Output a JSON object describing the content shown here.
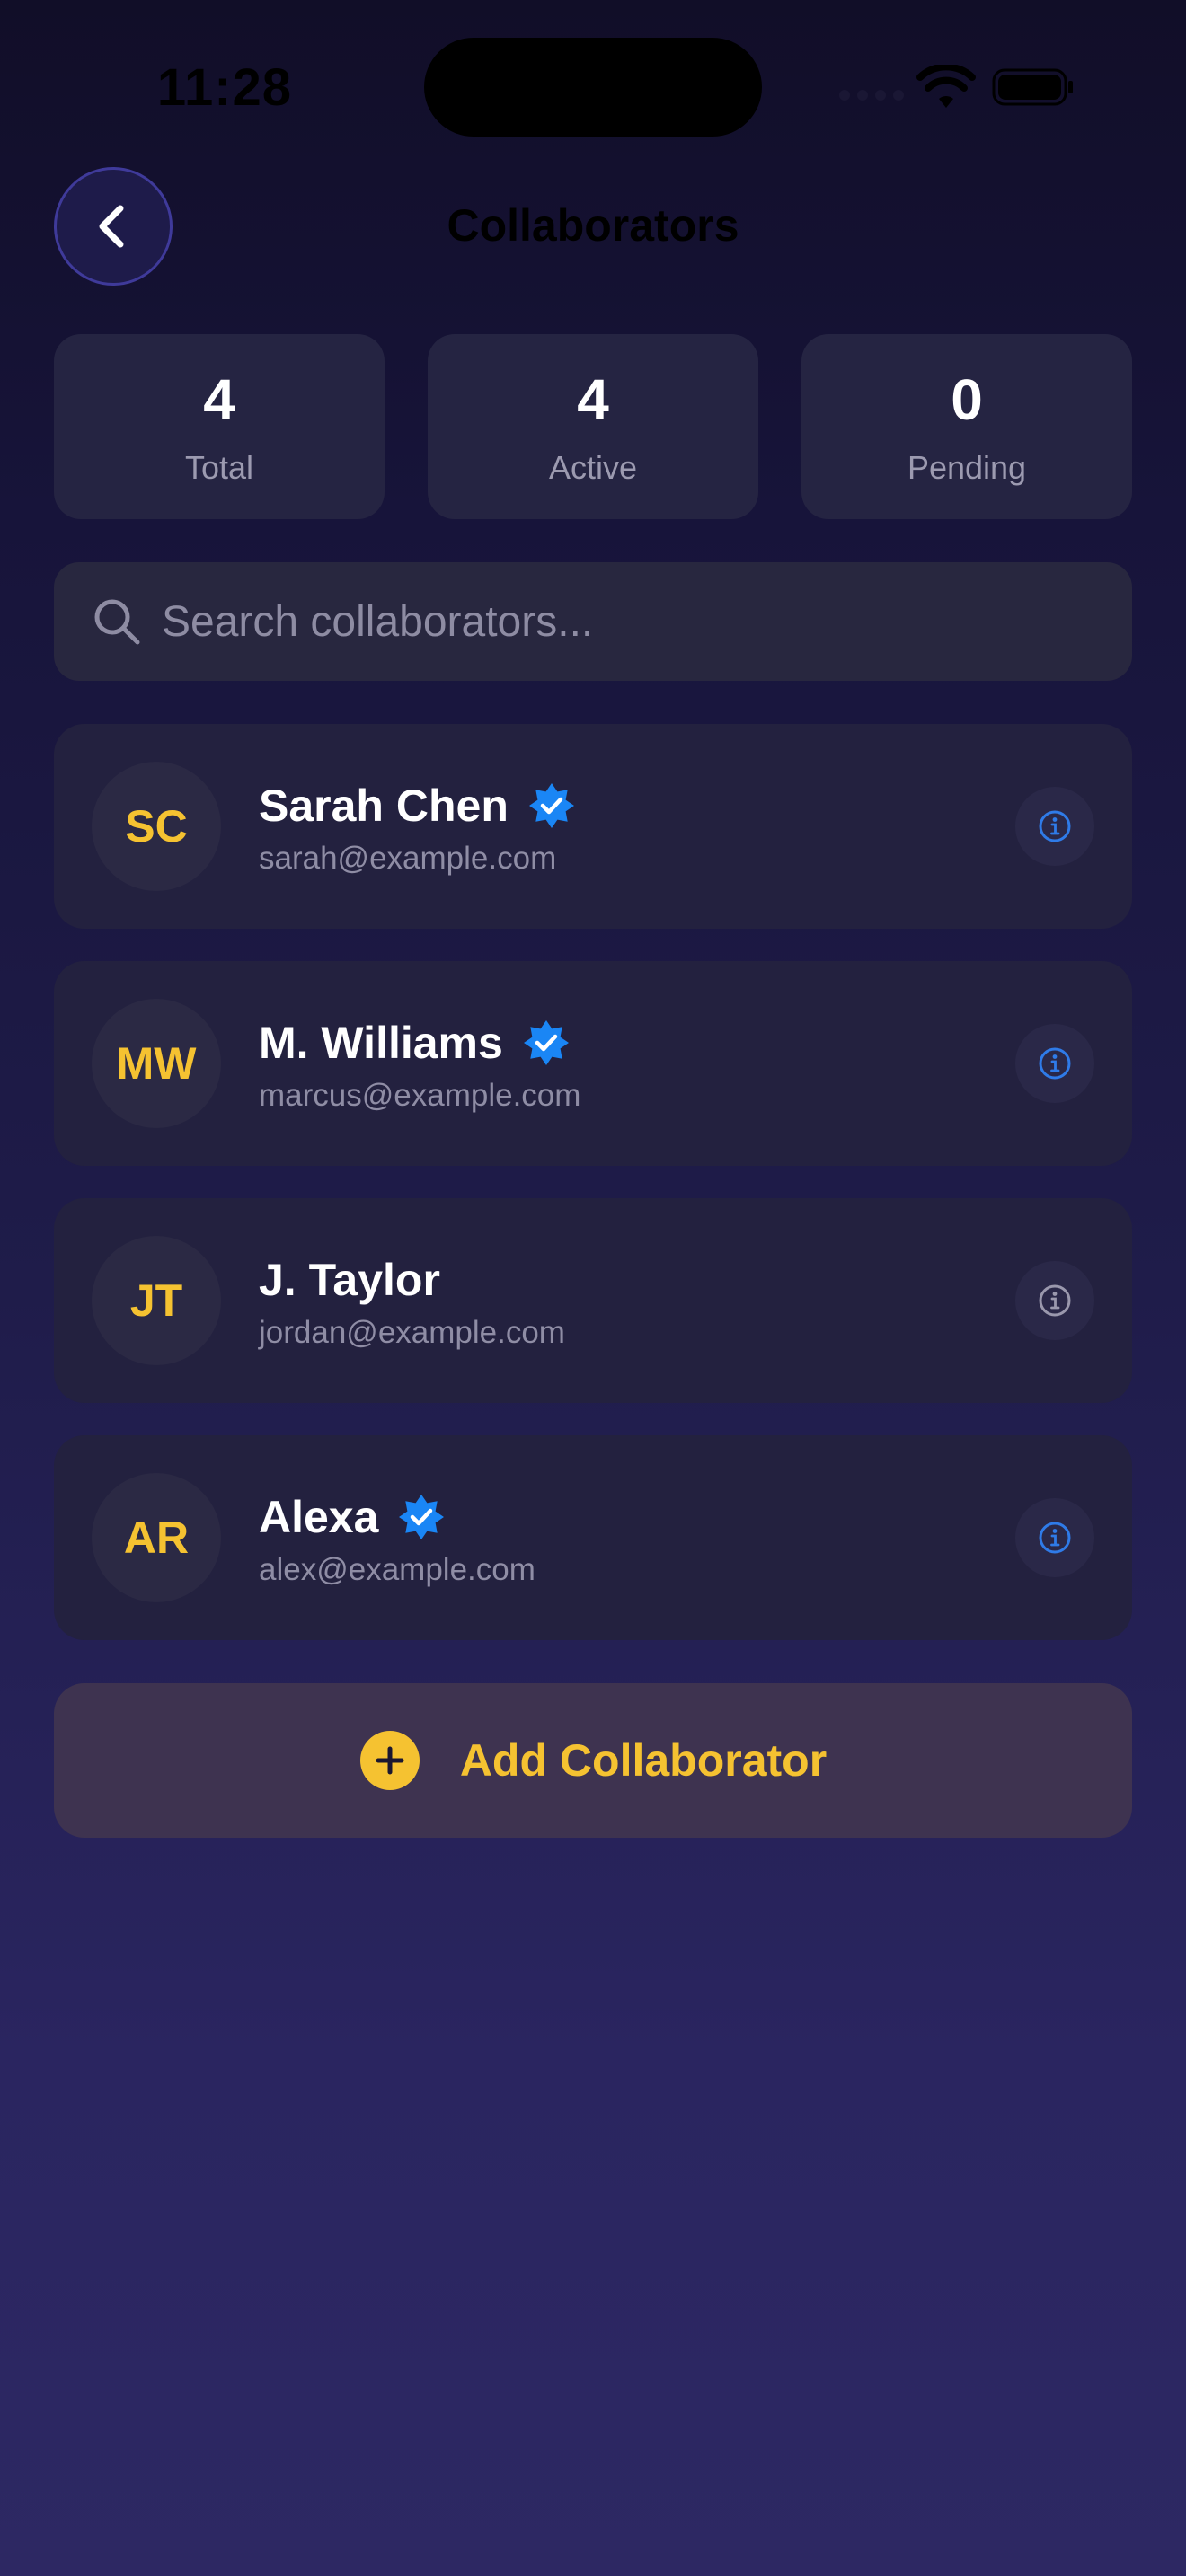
{
  "status_bar": {
    "time": "11:28"
  },
  "header": {
    "title": "Collaborators",
    "back_icon": "chevron-left-icon"
  },
  "stats": [
    {
      "value": "4",
      "label": "Total"
    },
    {
      "value": "4",
      "label": "Active"
    },
    {
      "value": "0",
      "label": "Pending"
    }
  ],
  "search": {
    "placeholder": "Search collaborators...",
    "value": "",
    "icon": "search-icon"
  },
  "collaborators": [
    {
      "initials": "SC",
      "name": "Sarah Chen",
      "email": "sarah@example.com",
      "verified": true
    },
    {
      "initials": "MW",
      "name": "M. Williams",
      "email": "marcus@example.com",
      "verified": true
    },
    {
      "initials": "JT",
      "name": "J. Taylor",
      "email": "jordan@example.com",
      "verified": false
    },
    {
      "initials": "AR",
      "name": "Alexa",
      "email": "alex@example.com",
      "verified": true
    }
  ],
  "add_button": {
    "label": "Add Collaborator",
    "icon": "plus-circle-icon"
  },
  "colors": {
    "accent_yellow": "#f5c231",
    "verified_blue": "#1a86f5",
    "info_blue": "#2f7be8",
    "info_gray": "#9a98ad",
    "card_bg": "#23213f"
  }
}
